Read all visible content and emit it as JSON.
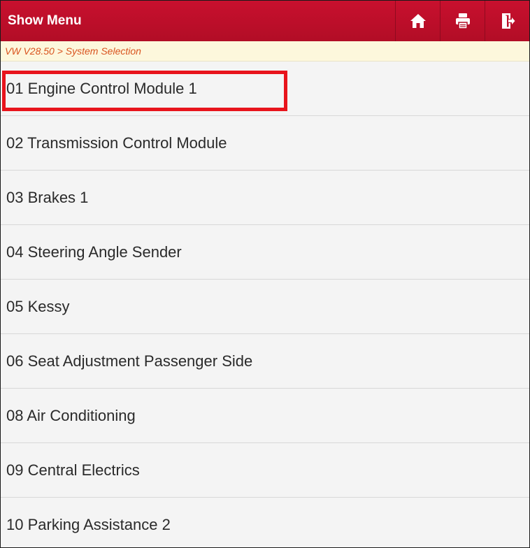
{
  "header": {
    "title": "Show Menu",
    "buttons": [
      {
        "name": "home",
        "icon": "home-icon"
      },
      {
        "name": "print",
        "icon": "printer-icon"
      },
      {
        "name": "exit",
        "icon": "exit-icon"
      }
    ]
  },
  "breadcrumb": "VW V28.50 > System Selection",
  "systems": [
    "01 Engine Control Module 1",
    "02 Transmission Control Module",
    "03 Brakes 1",
    "04 Steering Angle Sender",
    "05 Kessy",
    "06 Seat Adjustment Passenger Side",
    "08 Air Conditioning",
    "09 Central Electrics",
    "10 Parking Assistance 2"
  ],
  "colors": {
    "header": "#c8102e",
    "breadcrumb_text": "#d9531e",
    "highlight": "#e8141c"
  }
}
